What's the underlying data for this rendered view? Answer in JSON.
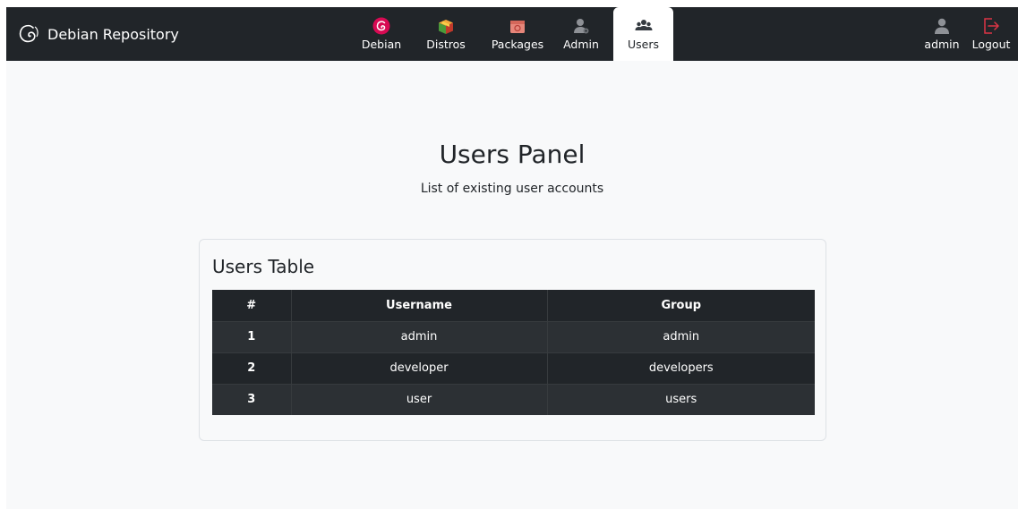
{
  "header": {
    "brand": "Debian Repository",
    "nav": [
      {
        "label": "Debian",
        "icon": "debian-swirl-icon"
      },
      {
        "label": "Distros",
        "icon": "box-icon"
      },
      {
        "label": "Packages",
        "icon": "package-icon"
      },
      {
        "label": "Admin",
        "icon": "admin-user-icon"
      },
      {
        "label": "Users",
        "icon": "users-group-icon",
        "active": true
      }
    ],
    "user": {
      "label": "admin",
      "icon": "user-icon"
    },
    "logout": {
      "label": "Logout",
      "icon": "logout-icon"
    }
  },
  "main": {
    "title": "Users Panel",
    "subtitle": "List of existing user accounts",
    "card": {
      "title": "Users Table",
      "columns": [
        "#",
        "Username",
        "Group"
      ],
      "rows": [
        [
          "1",
          "admin",
          "admin"
        ],
        [
          "2",
          "developer",
          "developers"
        ],
        [
          "3",
          "user",
          "users"
        ]
      ]
    }
  },
  "colors": {
    "navbar_bg": "#212529",
    "page_bg": "#f8f9fa",
    "debian_red": "#d70a53",
    "logout_red": "#dc3545"
  }
}
